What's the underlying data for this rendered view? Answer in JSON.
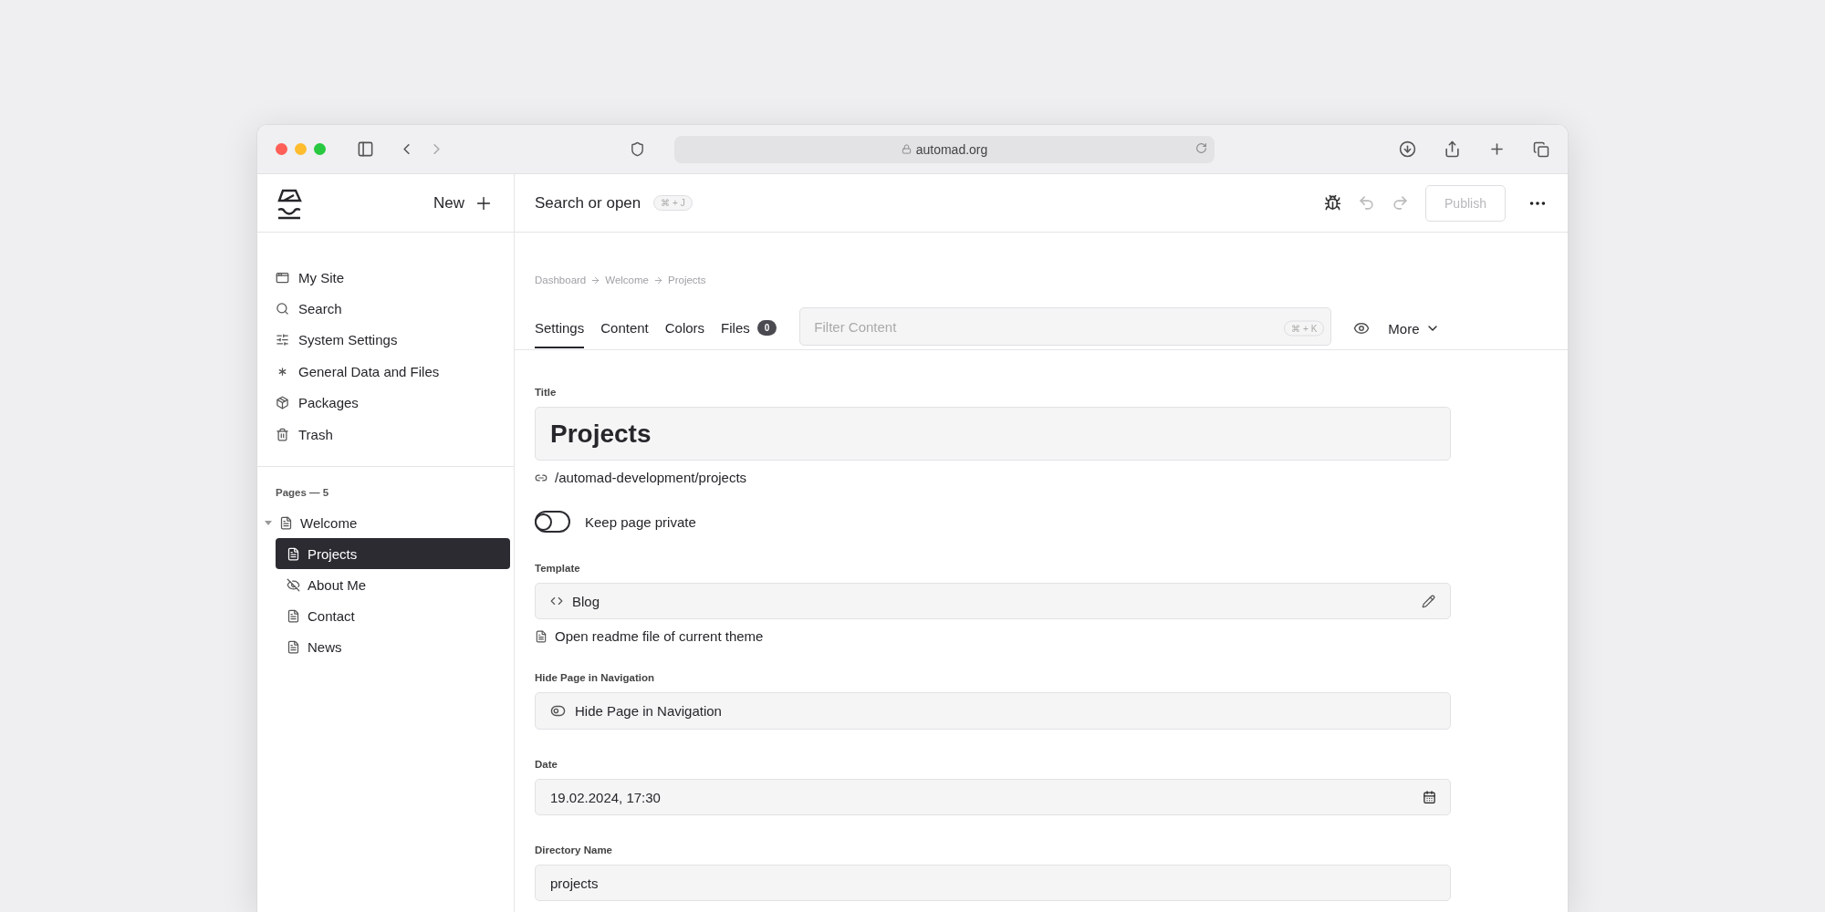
{
  "browser": {
    "url": "automad.org"
  },
  "sidebar": {
    "new_label": "New",
    "nav": [
      {
        "label": "My Site"
      },
      {
        "label": "Search"
      },
      {
        "label": "System Settings"
      },
      {
        "label": "General Data and Files"
      },
      {
        "label": "Packages"
      },
      {
        "label": "Trash"
      }
    ],
    "pages_heading": "Pages — 5",
    "pages": [
      {
        "label": "Welcome",
        "expanded": true,
        "selected": false,
        "hidden": false,
        "children": [
          {
            "label": "Projects",
            "selected": true,
            "hidden": false
          },
          {
            "label": "About Me",
            "selected": false,
            "hidden": true
          },
          {
            "label": "Contact",
            "selected": false,
            "hidden": false
          },
          {
            "label": "News",
            "selected": false,
            "hidden": false
          }
        ]
      }
    ]
  },
  "topbar": {
    "search_label": "Search or open",
    "search_shortcut": "⌘ + J",
    "publish": {
      "label": "Publish",
      "disabled": true
    }
  },
  "breadcrumb": [
    "Dashboard",
    "Welcome",
    "Projects"
  ],
  "tabs": [
    {
      "label": "Settings",
      "selected": true
    },
    {
      "label": "Content",
      "selected": false
    },
    {
      "label": "Colors",
      "selected": false
    },
    {
      "label": "Files",
      "selected": false,
      "badge": "0"
    }
  ],
  "filter": {
    "placeholder": "Filter Content",
    "shortcut": "⌘ + K"
  },
  "more_label": "More",
  "fields": [
    {
      "kind": "title",
      "label": "Title",
      "value": "Projects",
      "link": "/automad-development/projects"
    },
    {
      "kind": "switch",
      "label": "Keep page private",
      "on": false
    },
    {
      "kind": "template",
      "label": "Template",
      "value": "Blog",
      "link": "Open readme file of current theme"
    },
    {
      "kind": "select",
      "label": "Hide Page in Navigation",
      "value": "Hide Page in Navigation"
    },
    {
      "kind": "date",
      "label": "Date",
      "value": "19.02.2024, 17:30"
    },
    {
      "kind": "text",
      "label": "Directory Name",
      "value": "projects"
    }
  ]
}
